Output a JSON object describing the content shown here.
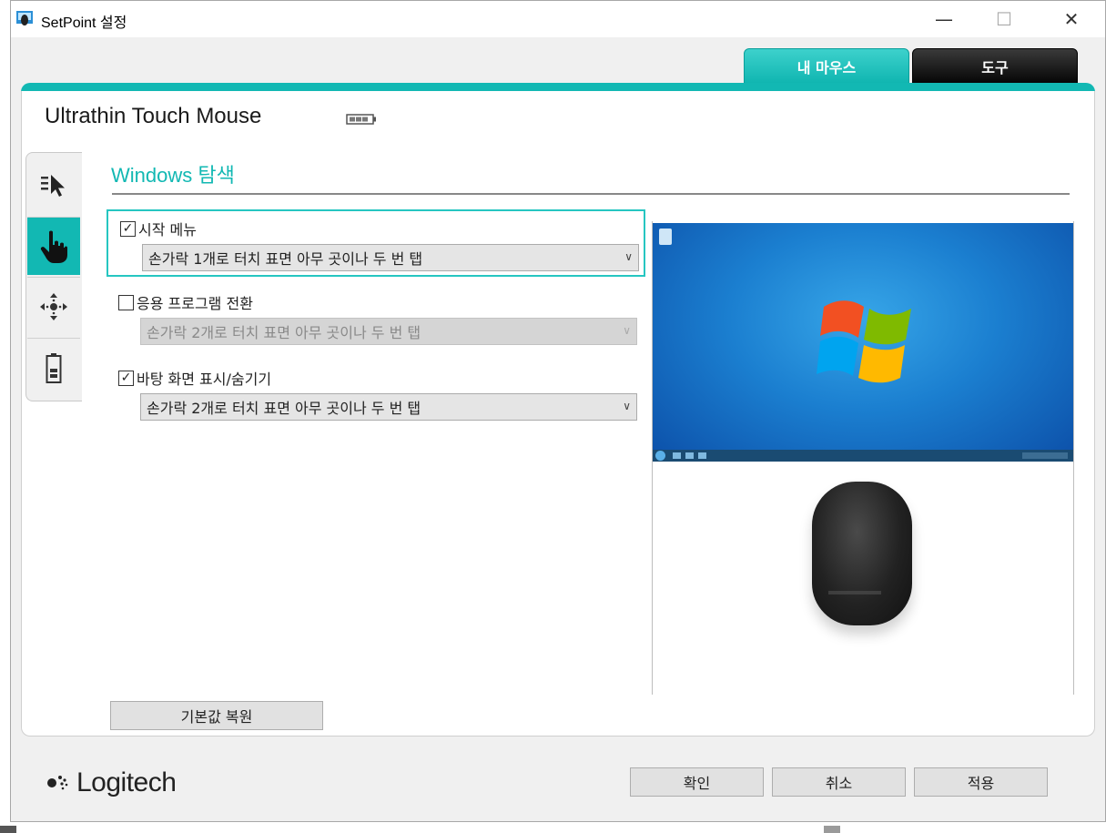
{
  "window": {
    "title": "SetPoint 설정",
    "controls": {
      "minimize": "—",
      "maximize": "☐",
      "close": "✕"
    }
  },
  "tabs": [
    {
      "label": "내 마우스",
      "active": true
    },
    {
      "label": "도구",
      "active": false
    }
  ],
  "device": {
    "name": "Ultrathin Touch Mouse",
    "battery_icon": "battery-icon"
  },
  "side_tabs": [
    {
      "icon": "pointer-icon",
      "active": false
    },
    {
      "icon": "touch-hand-icon",
      "active": true
    },
    {
      "icon": "scroll-move-icon",
      "active": false
    },
    {
      "icon": "battery-status-icon",
      "active": false
    }
  ],
  "section": {
    "title": "Windows 탐색"
  },
  "options": [
    {
      "label": "시작 메뉴",
      "checked": true,
      "gesture": "손가락 1개로 터치 표면 아무 곳이나 두 번 탭",
      "enabled": true
    },
    {
      "label": "응용 프로그램 전환",
      "checked": false,
      "gesture": "손가락 2개로 터치 표면 아무 곳이나 두 번 탭",
      "enabled": false
    },
    {
      "label": "바탕 화면 표시/숨기기",
      "checked": true,
      "gesture": "손가락 2개로 터치 표면 아무 곳이나 두 번 탭",
      "enabled": true
    }
  ],
  "buttons": {
    "restore_defaults": "기본값 복원",
    "ok": "확인",
    "cancel": "취소",
    "apply": "적용"
  },
  "brand": {
    "name": "Logitech"
  },
  "colors": {
    "accent": "#12b8b3",
    "tab_dark": "#111111"
  }
}
